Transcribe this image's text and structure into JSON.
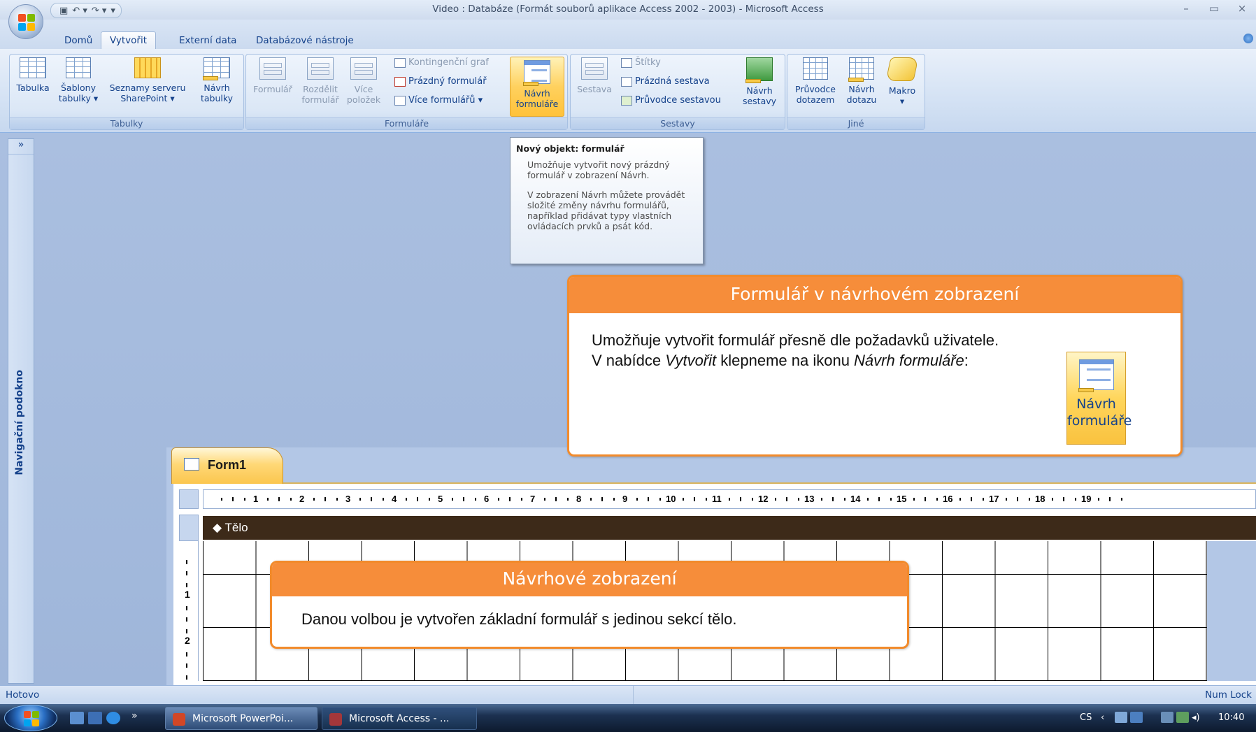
{
  "window": {
    "title": "Video : Databáze (Formát souborů aplikace Access 2002 - 2003) - Microsoft Access",
    "controls": [
      "–",
      "▭",
      "×"
    ]
  },
  "tabs": [
    {
      "label": "Domů",
      "selected": false
    },
    {
      "label": "Vytvořit",
      "selected": true
    },
    {
      "label": "Externí data",
      "selected": false
    },
    {
      "label": "Databázové nástroje",
      "selected": false
    }
  ],
  "ribbon": {
    "groups": {
      "tabulky": {
        "label": "Tabulky",
        "buttons": [
          "Tabulka",
          "Šablony\ntabulky ▾",
          "Seznamy serveru\nSharePoint ▾",
          "Návrh\ntabulky"
        ]
      },
      "formulare": {
        "label": "Formuláře",
        "buttons": [
          "Formulář",
          "Rozdělit\nformulář",
          "Více\npoložek",
          "Návrh\nformuláře"
        ],
        "small": [
          "Kontingenční graf",
          "Prázdný formulář",
          "Více formulářů ▾"
        ]
      },
      "sestavy": {
        "label": "Sestavy",
        "buttons": [
          "Sestava",
          "Návrh\nsestavy"
        ],
        "small": [
          "Štítky",
          "Prázdná sestava",
          "Průvodce sestavou"
        ]
      },
      "jine": {
        "label": "Jiné",
        "buttons": [
          "Průvodce\ndotazem",
          "Návrh\ndotazu",
          "Makro\n▾"
        ]
      }
    }
  },
  "tooltip": {
    "title": "Nový objekt: formulář",
    "p1": "Umožňuje vytvořit nový prázdný formulář v zobrazení Návrh.",
    "p2": "V zobrazení Návrh můžete provádět složité změny návrhu formulářů, například přidávat typy vlastních ovládacích prvků a psát kód."
  },
  "nav_pane": {
    "toggle": "»",
    "label": "Navigační podokno"
  },
  "form_window": {
    "tab_label": "Form1",
    "section_label": "◆ Tělo",
    "ruler_numbers": [
      "1",
      "2",
      "3",
      "4",
      "5",
      "6",
      "7",
      "8",
      "9",
      "10",
      "11",
      "12",
      "13",
      "14",
      "15",
      "16",
      "17",
      "18",
      "19"
    ],
    "vruler_numbers": [
      "1",
      "2"
    ]
  },
  "callouts": {
    "design_view_form": {
      "title": "Formulář v návrhovém zobrazení",
      "line1": "Umožňuje vytvořit formulář přesně dle požadavků uživatele.",
      "line2_prefix": "V nabídce ",
      "line2_menu": "Vytvořit",
      "line2_mid": " klepneme na ikonu ",
      "line2_icon": "Návrh formuláře",
      "line2_suffix": ":",
      "icon_label": "Návrh\nformuláře"
    },
    "design_view": {
      "title": "Návrhové zobrazení",
      "body": "Danou volbou je vytvořen základní formulář s jedinou sekcí tělo."
    }
  },
  "status": {
    "left": "Hotovo",
    "right": "Num Lock"
  },
  "taskbar": {
    "tasks": [
      {
        "label": "Microsoft PowerPoi...",
        "active": false
      },
      {
        "label": "Microsoft Access - ...",
        "active": true
      }
    ],
    "chevron": "»",
    "tray": {
      "lang": "CS",
      "clock": "10:40"
    }
  }
}
